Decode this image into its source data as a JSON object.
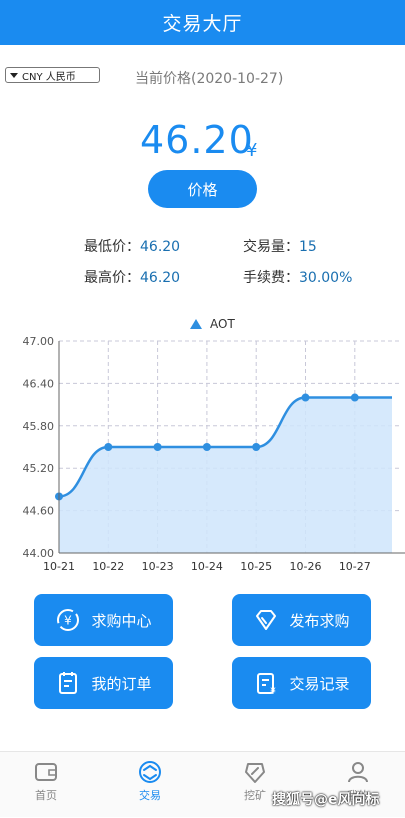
{
  "header": {
    "title": "交易大厅"
  },
  "currency": {
    "selected": "CNY 人民币"
  },
  "price": {
    "date_label": "当前价格(2020-10-27)",
    "value": "46.20",
    "unit": "¥",
    "button_label": "价格"
  },
  "stats": {
    "min_label": "最低价：",
    "min_value": "46.20",
    "volume_label": "交易量：",
    "volume_value": "15",
    "max_label": "最高价：",
    "max_value": "46.20",
    "fee_label": "手续费：",
    "fee_value": "30.00%"
  },
  "chart_data": {
    "type": "area",
    "title": "",
    "legend": "AOT",
    "x": [
      "10-21",
      "10-22",
      "10-23",
      "10-24",
      "10-25",
      "10-26",
      "10-27"
    ],
    "series": [
      {
        "name": "AOT",
        "values": [
          44.8,
          45.5,
          45.5,
          45.5,
          45.5,
          46.2,
          46.2
        ]
      }
    ],
    "ylim": [
      44.0,
      47.0
    ],
    "yticks": [
      "47.00",
      "46.40",
      "45.80",
      "45.20",
      "44.60",
      "44.00"
    ],
    "xlabel": "",
    "ylabel": "",
    "grid": true,
    "legend_position": "top-center",
    "colors": {
      "line": "#2f8fe0",
      "fill": "#cfe5fb"
    }
  },
  "actions": {
    "buy_center": "求购中心",
    "publish_buy": "发布求购",
    "my_orders": "我的订单",
    "trade_records": "交易记录"
  },
  "tabbar": {
    "home": "首页",
    "trade": "交易",
    "mining": "挖矿",
    "mine": "我的"
  },
  "watermark": "搜狐号@e风向标",
  "colors": {
    "accent": "#1a8bf0",
    "value_text": "#1a6fb0"
  }
}
